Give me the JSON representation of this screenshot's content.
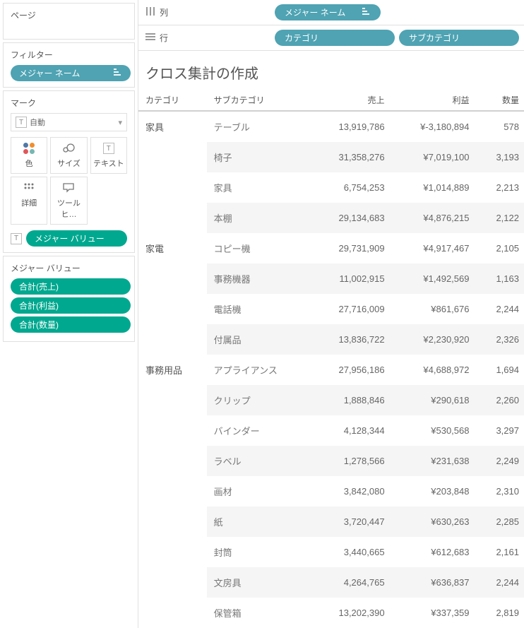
{
  "left": {
    "pages_title": "ページ",
    "filters_title": "フィルター",
    "filter_pill": "メジャー ネーム",
    "marks_title": "マーク",
    "marks_select_prefix": "自動",
    "mark_buttons": [
      {
        "label": "色"
      },
      {
        "label": "サイズ"
      },
      {
        "label": "テキスト"
      },
      {
        "label": "詳細"
      },
      {
        "label": "ツールヒ…"
      }
    ],
    "measure_value_pill": "メジャー バリュー",
    "measure_values_title": "メジャー バリュー",
    "measure_values": [
      "合計(売上)",
      "合計(利益)",
      "合計(数量)"
    ]
  },
  "shelves": {
    "columns_label": "列",
    "rows_label": "行",
    "columns_pill": "メジャー ネーム",
    "rows_pills": [
      "カテゴリ",
      "サブカテゴリ"
    ]
  },
  "viz": {
    "title": "クロス集計の作成",
    "headers": {
      "category": "カテゴリ",
      "subcategory": "サブカテゴリ",
      "sales": "売上",
      "profit": "利益",
      "quantity": "数量"
    }
  },
  "chart_data": {
    "type": "table",
    "columns": [
      "カテゴリ",
      "サブカテゴリ",
      "売上",
      "利益",
      "数量"
    ],
    "rows": [
      {
        "category": "家具",
        "subcategory": "テーブル",
        "sales": "13,919,786",
        "profit": "¥-3,180,894",
        "quantity": "578"
      },
      {
        "category": "",
        "subcategory": "椅子",
        "sales": "31,358,276",
        "profit": "¥7,019,100",
        "quantity": "3,193"
      },
      {
        "category": "",
        "subcategory": "家具",
        "sales": "6,754,253",
        "profit": "¥1,014,889",
        "quantity": "2,213"
      },
      {
        "category": "",
        "subcategory": "本棚",
        "sales": "29,134,683",
        "profit": "¥4,876,215",
        "quantity": "2,122"
      },
      {
        "category": "家電",
        "subcategory": "コピー機",
        "sales": "29,731,909",
        "profit": "¥4,917,467",
        "quantity": "2,105"
      },
      {
        "category": "",
        "subcategory": "事務機器",
        "sales": "11,002,915",
        "profit": "¥1,492,569",
        "quantity": "1,163"
      },
      {
        "category": "",
        "subcategory": "電話機",
        "sales": "27,716,009",
        "profit": "¥861,676",
        "quantity": "2,244"
      },
      {
        "category": "",
        "subcategory": "付属品",
        "sales": "13,836,722",
        "profit": "¥2,230,920",
        "quantity": "2,326"
      },
      {
        "category": "事務用品",
        "subcategory": "アプライアンス",
        "sales": "27,956,186",
        "profit": "¥4,688,972",
        "quantity": "1,694"
      },
      {
        "category": "",
        "subcategory": "クリップ",
        "sales": "1,888,846",
        "profit": "¥290,618",
        "quantity": "2,260"
      },
      {
        "category": "",
        "subcategory": "バインダー",
        "sales": "4,128,344",
        "profit": "¥530,568",
        "quantity": "3,297"
      },
      {
        "category": "",
        "subcategory": "ラベル",
        "sales": "1,278,566",
        "profit": "¥231,638",
        "quantity": "2,249"
      },
      {
        "category": "",
        "subcategory": "画材",
        "sales": "3,842,080",
        "profit": "¥203,848",
        "quantity": "2,310"
      },
      {
        "category": "",
        "subcategory": "紙",
        "sales": "3,720,447",
        "profit": "¥630,263",
        "quantity": "2,285"
      },
      {
        "category": "",
        "subcategory": "封筒",
        "sales": "3,440,665",
        "profit": "¥612,683",
        "quantity": "2,161"
      },
      {
        "category": "",
        "subcategory": "文房具",
        "sales": "4,264,765",
        "profit": "¥636,837",
        "quantity": "2,244"
      },
      {
        "category": "",
        "subcategory": "保管箱",
        "sales": "13,202,390",
        "profit": "¥337,359",
        "quantity": "2,819"
      }
    ]
  }
}
